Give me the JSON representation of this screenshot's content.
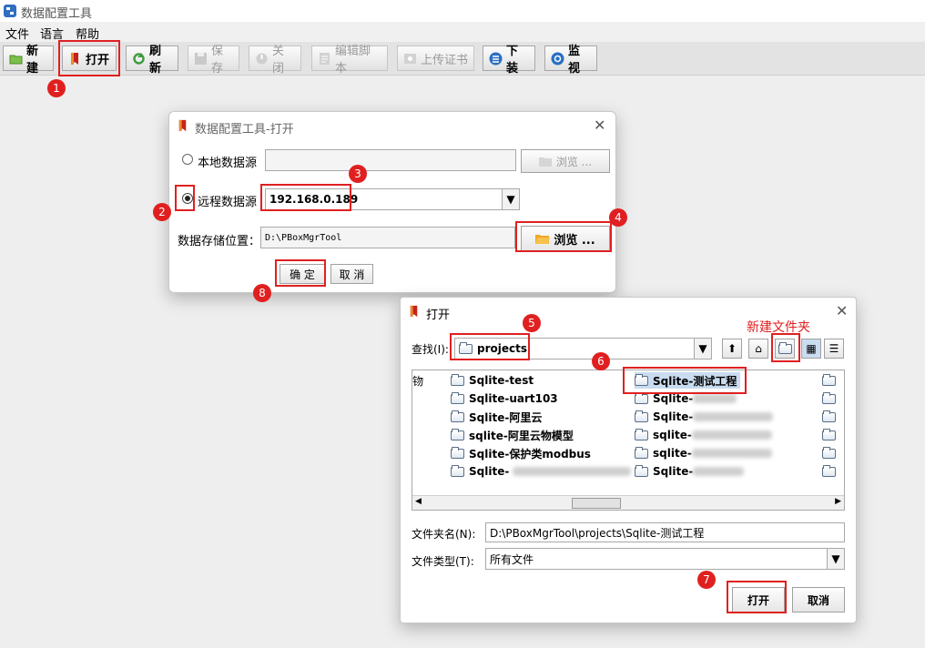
{
  "window": {
    "title": "数据配置工具"
  },
  "menu": [
    "文件",
    "语言",
    "帮助"
  ],
  "toolbar": [
    {
      "label": "新建",
      "icon": "folder-icon",
      "enabled": true
    },
    {
      "label": "打开",
      "icon": "book-icon",
      "enabled": true
    },
    {
      "label": "刷新",
      "icon": "refresh-icon",
      "enabled": true
    },
    {
      "label": "保存",
      "icon": "save-icon",
      "enabled": false
    },
    {
      "label": "关闭",
      "icon": "power-icon",
      "enabled": false
    },
    {
      "label": "编辑脚本",
      "icon": "script-icon",
      "enabled": false
    },
    {
      "label": "上传证书",
      "icon": "certificate-icon",
      "enabled": false
    },
    {
      "label": "下装",
      "icon": "list-icon",
      "enabled": true
    },
    {
      "label": "监视",
      "icon": "monitor-icon",
      "enabled": true
    }
  ],
  "open_dialog": {
    "title": "数据配置工具-打开",
    "local_label": "本地数据源",
    "local_value": "",
    "browse_label": "浏览 ...",
    "remote_label": "远程数据源",
    "remote_value": "192.168.0.189",
    "storage_label": "数据存储位置：",
    "storage_value": "D:\\PBoxMgrTool",
    "ok_label": "确 定",
    "cancel_label": "取 消"
  },
  "file_dialog": {
    "title": "打开",
    "look_in_label": "查找(I):",
    "look_in_value": "projects",
    "new_folder_note": "新建文件夹",
    "items_col0": [
      "Sqlite-test",
      "Sqlite-uart103",
      "Sqlite-阿里云",
      "sqlite-阿里云物模型",
      "Sqlite-保护类modbus",
      "Sqlite-"
    ],
    "items_col1": [
      "Sqlite-测试工程",
      "Sqlite-",
      "Sqlite-",
      "sqlite-",
      "sqlite-",
      "Sqlite-"
    ],
    "left_clip": "䥼",
    "filename_label": "文件夹名(N):",
    "filename_value": "D:\\PBoxMgrTool\\projects\\Sqlite-测试工程",
    "filetype_label": "文件类型(T):",
    "filetype_value": "所有文件",
    "open_label": "打开",
    "cancel_label": "取消"
  },
  "annotations": [
    "1",
    "2",
    "3",
    "4",
    "5",
    "6",
    "7",
    "8"
  ],
  "colors": {
    "highlight": "#e02020",
    "selected": "#c9dcf0"
  }
}
